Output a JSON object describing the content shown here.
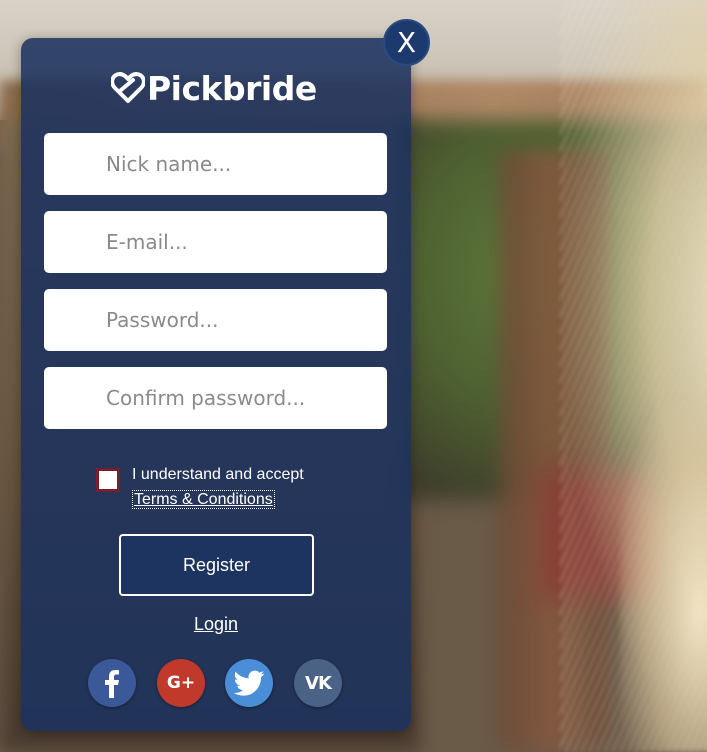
{
  "brand": {
    "name": "Pickbride"
  },
  "close_label": "X",
  "form": {
    "nickname_placeholder": "Nick name...",
    "email_placeholder": "E-mail...",
    "password_placeholder": "Password...",
    "confirm_placeholder": "Confirm password..."
  },
  "agree": {
    "text": "I understand and accept",
    "terms_link": "Terms & Conditions",
    "checked": false
  },
  "register_label": "Register",
  "login_label": "Login",
  "social": [
    {
      "icon": "facebook-icon",
      "color": "#3b5998",
      "glyph": "f"
    },
    {
      "icon": "google-plus-icon",
      "color": "#c0392b",
      "glyph": "G+"
    },
    {
      "icon": "twitter-icon",
      "color": "#4a8ed8",
      "glyph": ""
    },
    {
      "icon": "vk-icon",
      "color": "#4a6286",
      "glyph": "VK"
    }
  ],
  "colors": {
    "modal_bg": "#1d325e",
    "close_bg": "#1d3a6e",
    "checkbox_border": "#7a1f2a"
  }
}
